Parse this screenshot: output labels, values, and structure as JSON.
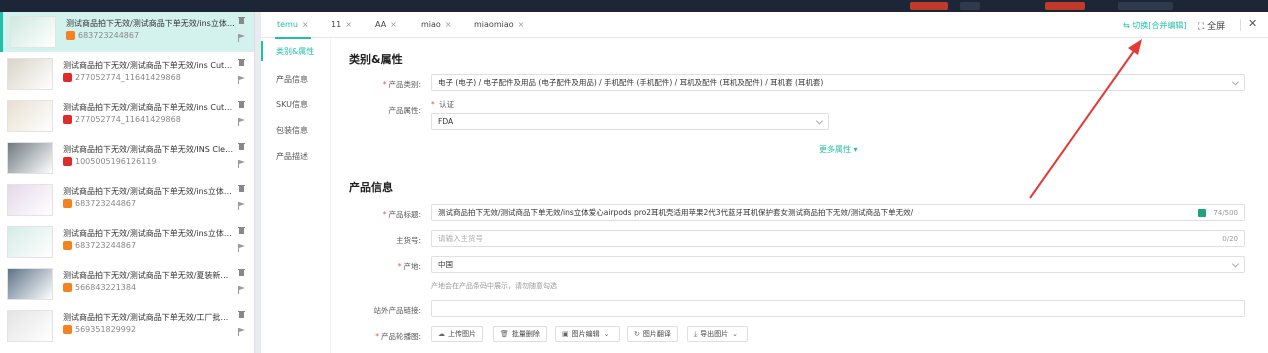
{
  "colors": {
    "accent": "#1fbfa8",
    "required": "#f05050",
    "arrow": "#e53935"
  },
  "products": [
    {
      "title": "测试商品拍下无效/测试商品下单无效/ins立体爱心a...",
      "id": "683723244867",
      "platform": "orange",
      "selected": true
    },
    {
      "title": "测试商品拍下无效/测试商品下单无效/ins Cute Bea...",
      "id": "277052774_11641429868",
      "platform": "red",
      "selected": false
    },
    {
      "title": "测试商品拍下无效/测试商品下单无效/ins Cute Bea...",
      "id": "277052774_11641429868",
      "platform": "red",
      "selected": false
    },
    {
      "title": "测试商品拍下无效/测试商品下单无效/INS Clear Bl...",
      "id": "1005005196126119",
      "platform": "red",
      "selected": false
    },
    {
      "title": "测试商品拍下无效/测试商品下单无效/ins立体爱心a...",
      "id": "683723244867",
      "platform": "orange",
      "selected": false
    },
    {
      "title": "测试商品拍下无效/测试商品下单无效/ins立体爱心a...",
      "id": "683723244867",
      "platform": "orange",
      "selected": false
    },
    {
      "title": "测试商品拍下无效/测试商品下单无效/夏装新款女装...",
      "id": "566843221384",
      "platform": "orange",
      "selected": false
    },
    {
      "title": "测试商品拍下无效/测试商品下单无效/工厂批发女装...",
      "id": "569351829992",
      "platform": "orange",
      "selected": false
    }
  ],
  "tabs": [
    {
      "label": "temu",
      "active": true
    },
    {
      "label": "11",
      "active": false
    },
    {
      "label": "AA",
      "active": false
    },
    {
      "label": "miao",
      "active": false
    },
    {
      "label": "miaomiao",
      "active": false
    }
  ],
  "toolbar": {
    "merge_label": "⇆ 切换[合并编辑]",
    "fullscreen_label": "⛶ 全屏",
    "close_label": "✕"
  },
  "sidenav": [
    "类别&属性",
    "产品信息",
    "SKU信息",
    "包装信息",
    "产品描述"
  ],
  "category_section": {
    "title": "类别&属性",
    "category_label": "产品类别:",
    "category_value": "电子 (电子) / 电子配件及用品 (电子配件及用品) / 手机配件 (手机配件) / 耳机及配件 (耳机及配件) / 耳机套 (耳机套)",
    "attr_label": "产品属性:",
    "cert_label": "认证",
    "cert_value": "FDA",
    "more_label": "更多属性 ▾"
  },
  "product_section": {
    "title": "产品信息",
    "title_label": "产品标题:",
    "title_value": "测试商品拍下无效/测试商品下单无效/ins立体爱心airpods pro2耳机壳适用苹果2代3代蓝牙耳机保护套女测试商品拍下无效/测试商品下单无效/",
    "title_count": "74/500",
    "sku_label": "主货号:",
    "sku_placeholder": "请输入主货号",
    "sku_count": "0/20",
    "origin_label": "产地:",
    "origin_value": "中国",
    "origin_hint": "产地会在产品条码中展示，请勿随意勾选",
    "link_label": "站外产品链接:",
    "carousel_label": "产品轮播图:",
    "buttons": [
      "上传图片",
      "批量删除",
      "图片编辑",
      "图片翻译",
      "导出图片"
    ]
  }
}
